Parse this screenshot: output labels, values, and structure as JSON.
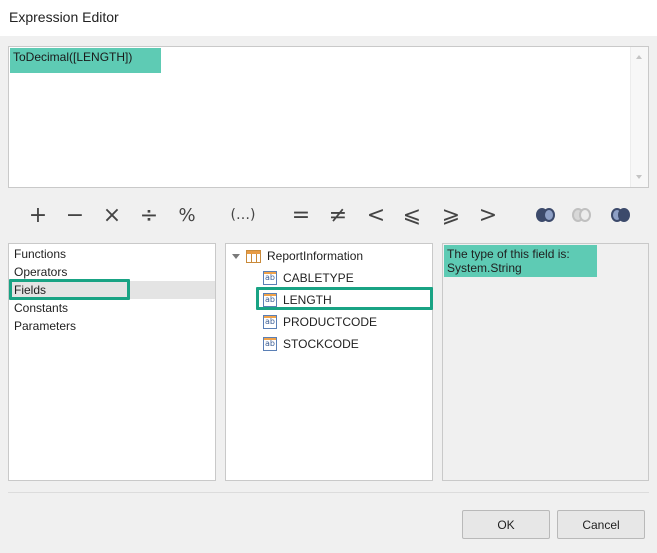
{
  "window": {
    "title": "Expression Editor"
  },
  "expression": {
    "text": "ToDecimal([LENGTH])"
  },
  "operators": [
    {
      "symbol": "+",
      "name": "plus"
    },
    {
      "symbol": "−",
      "name": "minus"
    },
    {
      "symbol": "×",
      "name": "multiply"
    },
    {
      "symbol": "÷",
      "name": "divide"
    },
    {
      "symbol": "%",
      "name": "modulo"
    },
    {
      "symbol": "(…)",
      "name": "parentheses"
    },
    {
      "symbol": "=",
      "name": "equal"
    },
    {
      "symbol": "≠",
      "name": "not-equal"
    },
    {
      "symbol": "<",
      "name": "less-than"
    },
    {
      "symbol": "⩽",
      "name": "less-or-equal"
    },
    {
      "symbol": "⩾",
      "name": "greater-or-equal"
    },
    {
      "symbol": ">",
      "name": "greater-than"
    }
  ],
  "logic_icons": [
    "and-icon",
    "or-icon",
    "not-icon"
  ],
  "categories": [
    "Functions",
    "Operators",
    "Fields",
    "Constants",
    "Parameters"
  ],
  "selected_category": "Fields",
  "tree": {
    "root": "ReportInformation",
    "fields": [
      "CABLETYPE",
      "LENGTH",
      "PRODUCTCODE",
      "STOCKCODE"
    ],
    "selected_field": "LENGTH",
    "field_icon_text": "ab"
  },
  "description": {
    "line1": "The type of this field is:",
    "line2": "System.String"
  },
  "buttons": {
    "ok": "OK",
    "cancel": "Cancel"
  },
  "colors": {
    "highlight": "#5ecbb4",
    "annotation_border": "#19a384"
  }
}
